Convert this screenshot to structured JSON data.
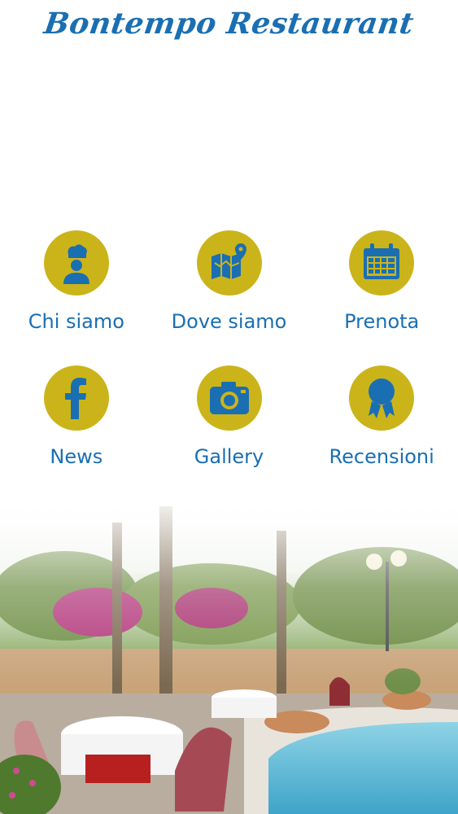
{
  "header": {
    "title": "Bontempo Restaurant"
  },
  "menu": {
    "items": [
      {
        "label": "Chi siamo",
        "icon": "chef-icon"
      },
      {
        "label": "Dove siamo",
        "icon": "map-icon"
      },
      {
        "label": "Prenota",
        "icon": "calendar-icon"
      },
      {
        "label": "News",
        "icon": "facebook-icon"
      },
      {
        "label": "Gallery",
        "icon": "camera-icon"
      },
      {
        "label": "Recensioni",
        "icon": "award-icon"
      }
    ]
  },
  "colors": {
    "accent": "#cbb41a",
    "brand": "#1a6fb3"
  }
}
